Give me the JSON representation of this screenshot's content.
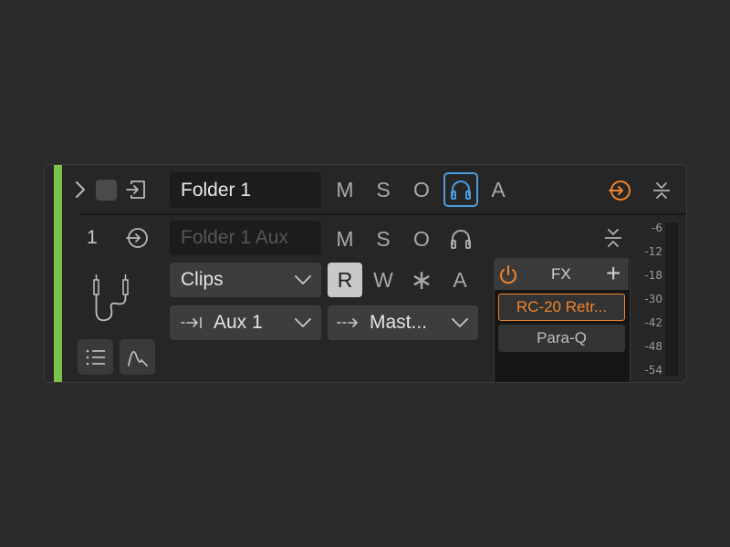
{
  "folder_track": {
    "name": "Folder 1",
    "buttons": {
      "mute": "M",
      "solo": "S",
      "monitor": "O",
      "automation": "A"
    },
    "monitor_headphones_active": true,
    "accent_color": "#7cc14a",
    "active_blue": "#4a9de0",
    "orange": "#f0842c"
  },
  "aux_track": {
    "number": "1",
    "name_placeholder": "Folder 1 Aux",
    "buttons": {
      "mute": "M",
      "solo": "S",
      "monitor": "O"
    },
    "clips_dropdown": "Clips",
    "automation_modes": {
      "read": "R",
      "write": "W",
      "touch": "∗",
      "latch": "A"
    },
    "read_active": true,
    "input_routing": "Aux 1",
    "output_routing": "Mast..."
  },
  "fx": {
    "label": "FX",
    "add_label": "+",
    "power_on": true,
    "slots": [
      {
        "name": "RC-20 Retr...",
        "active": true
      },
      {
        "name": "Para-Q",
        "active": false
      }
    ]
  },
  "meter": {
    "scale": [
      "-6",
      "-12",
      "-18",
      "-30",
      "-42",
      "-48",
      "-54"
    ]
  }
}
